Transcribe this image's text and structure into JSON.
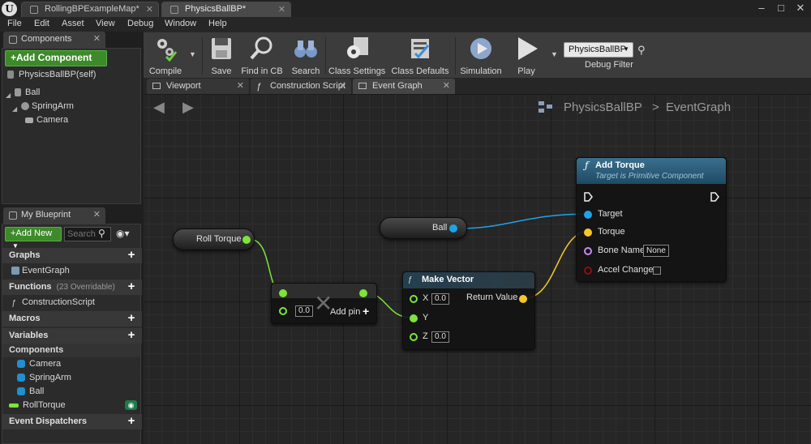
{
  "window": {
    "tabs": [
      {
        "label": "RollingBPExampleMap*"
      },
      {
        "label": "PhysicsBallBP*"
      }
    ]
  },
  "menu": [
    "File",
    "Edit",
    "Asset",
    "View",
    "Debug",
    "Window",
    "Help"
  ],
  "components_panel": {
    "tab_label": "Components",
    "add_button": "+Add Component",
    "self_label": "PhysicsBallBP(self)",
    "tree": [
      "Ball",
      "SpringArm",
      "Camera"
    ]
  },
  "my_blueprint": {
    "tab_label": "My Blueprint",
    "add_new": "+Add New",
    "search_placeholder": "Search",
    "graphs_header": "Graphs",
    "graphs_items": [
      "EventGraph"
    ],
    "functions_header": "Functions",
    "functions_count": "(23 Overridable)",
    "functions_items": [
      "ConstructionScript"
    ],
    "macros_header": "Macros",
    "variables_header": "Variables",
    "components_header": "Components",
    "component_vars": [
      "Camera",
      "SpringArm",
      "Ball"
    ],
    "variable_items": [
      "RollTorque"
    ],
    "event_dispatchers_header": "Event Dispatchers"
  },
  "toolbar": {
    "buttons": [
      "Compile",
      "Save",
      "Find in CB",
      "Search",
      "Class Settings",
      "Class Defaults",
      "Simulation",
      "Play"
    ],
    "debug_filter_value": "PhysicsBallBP",
    "debug_filter_label": "Debug Filter"
  },
  "sub_tabs": [
    "Viewport",
    "Construction Script",
    "Event Graph"
  ],
  "breadcrumb": {
    "blueprint": "PhysicsBallBP",
    "separator": ">",
    "graph": "EventGraph"
  },
  "nodes": {
    "roll_torque": {
      "label": "Roll Torque"
    },
    "ball": {
      "label": "Ball"
    },
    "add_node": {
      "value": "0.0",
      "add_pin": "Add pin"
    },
    "make_vector": {
      "title": "Make Vector",
      "x_label": "X",
      "x_value": "0.0",
      "y_label": "Y",
      "z_label": "Z",
      "z_value": "0.0",
      "return_label": "Return Value"
    },
    "add_torque": {
      "title": "Add Torque",
      "subtitle": "Target is Primitive Component",
      "target": "Target",
      "torque": "Torque",
      "bone_name_label": "Bone Name",
      "bone_name_value": "None",
      "accel_change": "Accel Change"
    }
  },
  "colors": {
    "float_pin": "#7ee33a",
    "object_pin": "#1fa3e6",
    "vector_pin": "#f6c626",
    "name_pin": "#c68cf2",
    "bool_pin": "#8e0f0f",
    "function_header": "#2a5e7a",
    "pure_header": "#24404f",
    "add_component_green": "#3d8a2a"
  }
}
